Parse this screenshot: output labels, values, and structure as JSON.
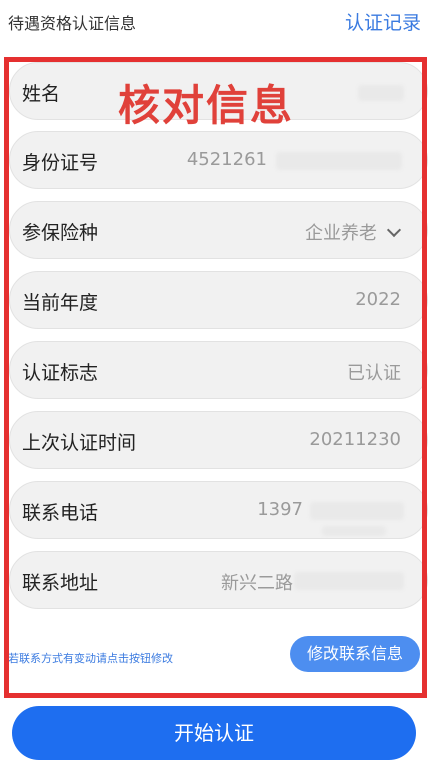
{
  "header": {
    "title": "待遇资格认证信息",
    "link": "认证记录"
  },
  "overlay_text": "核对信息",
  "rows": [
    {
      "label": "姓名",
      "value": ""
    },
    {
      "label": "身份证号",
      "value": "4521261"
    },
    {
      "label": "参保险种",
      "value": "企业养老"
    },
    {
      "label": "当前年度",
      "value": "2022"
    },
    {
      "label": "认证标志",
      "value": "已认证"
    },
    {
      "label": "上次认证时间",
      "value": "20211230"
    },
    {
      "label": "联系电话",
      "value": "1397"
    },
    {
      "label": "联系地址",
      "value": "新兴二路"
    }
  ],
  "hint": "若联系方式有变动请点击按钮修改",
  "buttons": {
    "modify": "修改联系信息",
    "start": "开始认证"
  },
  "colors": {
    "accent": "#1e6ef0",
    "link": "#3b7be0",
    "annotation": "#e53030"
  }
}
